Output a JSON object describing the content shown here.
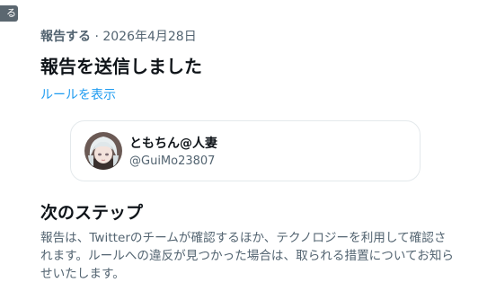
{
  "corner_tag": "る",
  "report": {
    "action_label": "報告する",
    "separator": " · ",
    "date": "2026年4月28日",
    "title": "報告を送信しました",
    "rules_link": "ルールを表示"
  },
  "user": {
    "display_name": "ともちん@人妻",
    "handle": "@GuiMo23807"
  },
  "next_steps": {
    "title": "次のステップ",
    "body": "報告は、Twitterのチームが確認するほか、テクノロジーを利用して確認されます。ルールへの違反が見つかった場合は、取られる措置についてお知らせいたします。"
  },
  "colors": {
    "text_primary": "#0f1419",
    "text_secondary": "#536471",
    "link": "#1d9bf0",
    "card_border": "#e4e9ec"
  }
}
